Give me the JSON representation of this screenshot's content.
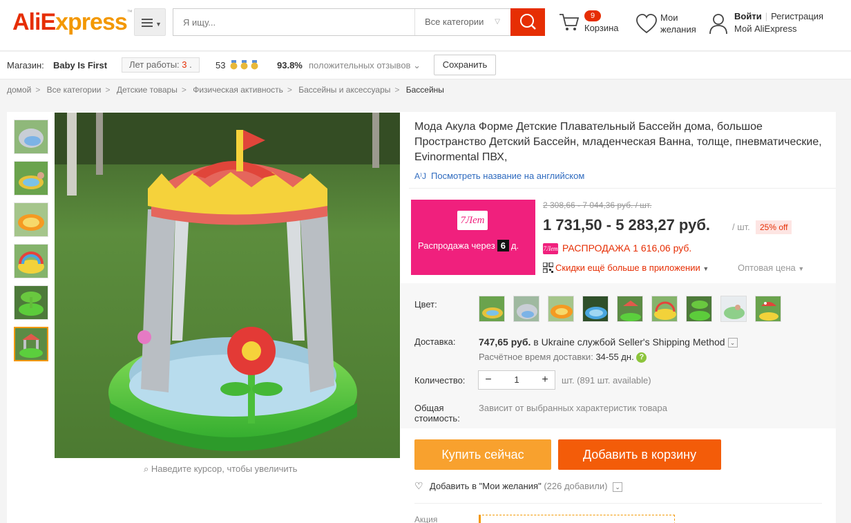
{
  "header": {
    "logo_main": "AliE",
    "logo_accent": "xpress",
    "logo_tm": "™",
    "search_placeholder": "Я ищу...",
    "category": "Все категории",
    "cart_count": "9",
    "cart_label": "Корзина",
    "wishlist_label_1": "Мои",
    "wishlist_label_2": "желания",
    "login": "Войти",
    "register": "Регистрация",
    "my_account": "Мой AliExpress",
    "accent_color": "#e62e04"
  },
  "store": {
    "label": "Магазин:",
    "name": "Baby Is First",
    "years_label": "Лет работы:",
    "years_value": "3",
    "years_dot": ".",
    "score": "53",
    "positive_pct": "93.8%",
    "positive_label": "положительных отзывов",
    "save_label": "Сохранить"
  },
  "breadcrumb": [
    "домой",
    "Все категории",
    "Детские товары",
    "Физическая активность",
    "Бассейны и аксессуары",
    "Бассейны"
  ],
  "product": {
    "title": "Мода Акула Форме Детские Плавательный Бассейн дома, большое Пространство Детский Бассейн, младенческая Ванна, толще, пневматические, Evinormental ПВХ,",
    "english_link": "Посмотреть название на английском",
    "zoom_hint": "Наведите курсор, чтобы увеличить"
  },
  "promo": {
    "tag": "7Лет",
    "text": "Распродажа через",
    "days": "6",
    "days_suffix": "д."
  },
  "pricing": {
    "old_price": "2 308,66 - 7 044,36 руб. / шт.",
    "price": "1 731,50 - 5 283,27 руб.",
    "unit": "/ шт.",
    "discount": "25% off",
    "sale_tag": "7Лет",
    "sale_price": "РАСПРОДАЖА 1 616,06 руб.",
    "app_discount": "Скидки ещё больше в приложении",
    "wholesale": "Оптовая цена"
  },
  "options": {
    "color_label": "Цвет:",
    "delivery_label": "Доставка:",
    "delivery_price": "747,65 руб.",
    "delivery_text": "в Ukraine службой Seller's Shipping Method",
    "est_label": "Расчётное время доставки:",
    "est_value": "34-55 дн.",
    "qty_label": "Количество:",
    "qty_value": "1",
    "qty_avail": "шт. (891 шт. available)",
    "total_label_1": "Общая",
    "total_label_2": "стоимость:",
    "total_value": "Зависит от выбранных характеристик товара"
  },
  "actions": {
    "buy_now": "Купить сейчас",
    "add_to_cart": "Добавить в корзину",
    "add_wishlist": "Добавить в \"Мои желания\"",
    "wishlist_count": "(226 добавили)",
    "akcia": "Акция"
  }
}
